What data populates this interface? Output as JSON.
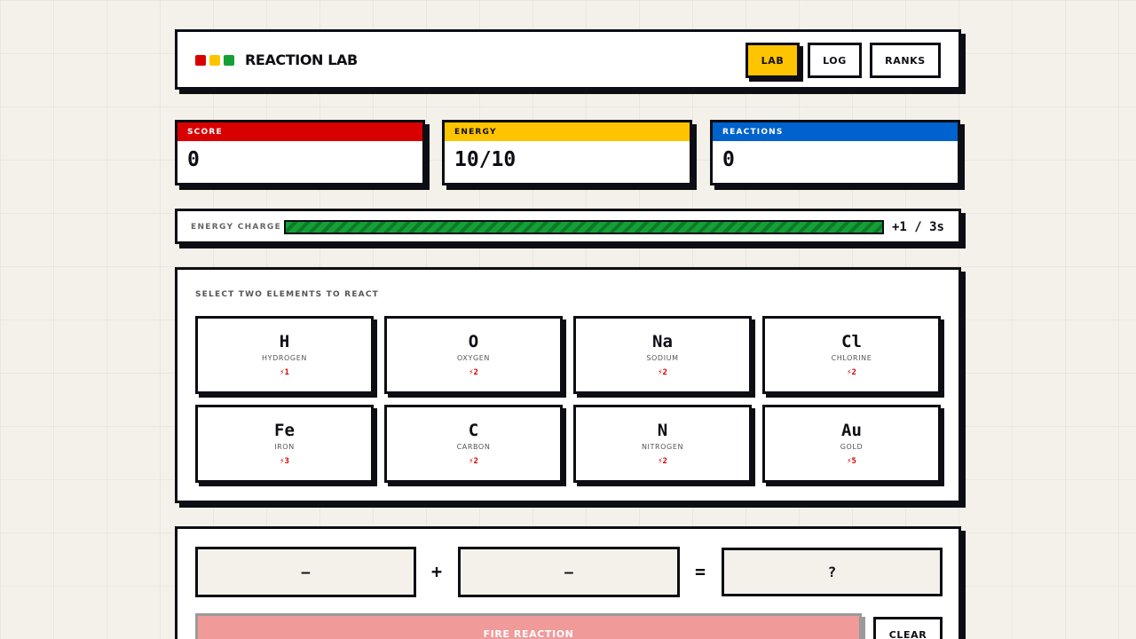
{
  "header": {
    "brand": "REACTION LAB",
    "dot_colors": [
      "#d90000",
      "#ffc400",
      "#14a037"
    ],
    "nav": [
      {
        "label": "LAB",
        "active": true
      },
      {
        "label": "LOG",
        "active": false
      },
      {
        "label": "RANKS",
        "active": false
      }
    ]
  },
  "stats": {
    "score": {
      "label": "SCORE",
      "value": "0",
      "color": "#d90000"
    },
    "energy": {
      "label": "ENERGY",
      "value": "10/10",
      "color": "#ffc400"
    },
    "reactions": {
      "label": "REACTIONS",
      "value": "0",
      "color": "#0062cc"
    }
  },
  "charge": {
    "label": "ENERGY CHARGE",
    "fill_fraction": 1.0,
    "rate": "+1 / 3s"
  },
  "elements": {
    "title": "SELECT TWO ELEMENTS TO REACT",
    "items": [
      {
        "symbol": "H",
        "name": "HYDROGEN",
        "cost": "⚡1"
      },
      {
        "symbol": "O",
        "name": "OXYGEN",
        "cost": "⚡2"
      },
      {
        "symbol": "Na",
        "name": "SODIUM",
        "cost": "⚡2"
      },
      {
        "symbol": "Cl",
        "name": "CHLORINE",
        "cost": "⚡2"
      },
      {
        "symbol": "Fe",
        "name": "IRON",
        "cost": "⚡3"
      },
      {
        "symbol": "C",
        "name": "CARBON",
        "cost": "⚡2"
      },
      {
        "symbol": "N",
        "name": "NITROGEN",
        "cost": "⚡2"
      },
      {
        "symbol": "Au",
        "name": "GOLD",
        "cost": "⚡5"
      }
    ]
  },
  "reaction": {
    "slot_a": "—",
    "plus": "+",
    "slot_b": "—",
    "equals": "=",
    "result": "?",
    "fire_label": "FIRE REACTION",
    "clear_label": "CLEAR"
  }
}
